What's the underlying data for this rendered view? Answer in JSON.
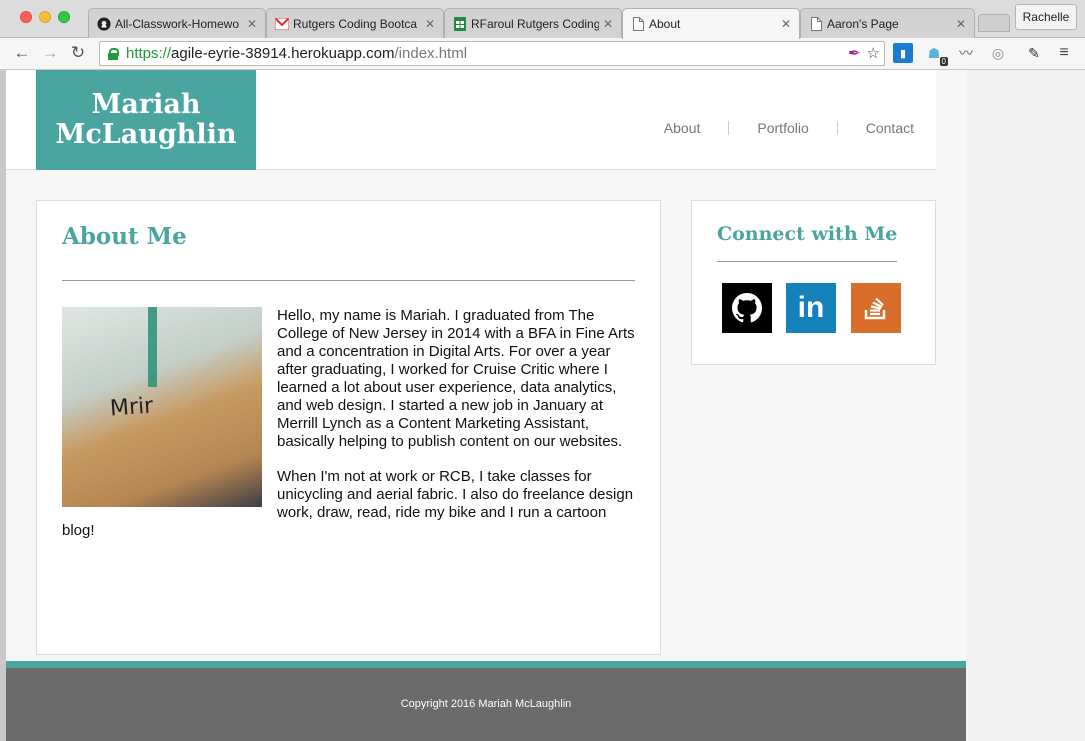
{
  "browser": {
    "tabs": [
      {
        "label": "All-Classwork-Homewo",
        "icon": "github-icon",
        "active": false
      },
      {
        "label": "Rutgers Coding Bootca",
        "icon": "gmail-icon",
        "active": false
      },
      {
        "label": "RFaroul Rutgers Coding",
        "icon": "sheets-icon",
        "active": false
      },
      {
        "label": "About",
        "icon": "page-icon",
        "active": true
      },
      {
        "label": "Aaron's Page",
        "icon": "page-icon",
        "active": false
      }
    ],
    "profile": "Rachelle",
    "url": {
      "scheme": "https://",
      "host": "agile-eyrie-38914.herokuapp.com",
      "path": "/index.html"
    },
    "extension_badge": "0"
  },
  "site": {
    "logo_line1": "Mariah",
    "logo_line2": "McLaughlin",
    "nav": [
      "About",
      "Portfolio",
      "Contact"
    ],
    "about": {
      "heading": "About Me",
      "photo_caption": "Mrir",
      "paragraph1": "Hello, my name is Mariah. I graduated from The College of New Jersey in 2014 with a BFA in Fine Arts and a concentration in Digital Arts. For over a year after graduating, I worked for Cruise Critic where I learned a lot about user experience, data analytics, and web design. I started a new job in January at Merrill Lynch as a Content Marketing Assistant, basically helping to publish content on our websites.",
      "paragraph2": "When I'm not at work or RCB, I take classes for unicycling and aerial fabric. I also do freelance design work, draw, read, ride my bike and I run a cartoon blog!"
    },
    "connect": {
      "heading": "Connect with Me",
      "linkedin_label": "in"
    },
    "footer": "Copyright 2016 Mariah McLaughlin"
  },
  "colors": {
    "accent": "#4aa5a0",
    "footer": "#6b6b6b",
    "github": "#000000",
    "linkedin": "#1582bb",
    "stackoverflow": "#d96e2b"
  }
}
